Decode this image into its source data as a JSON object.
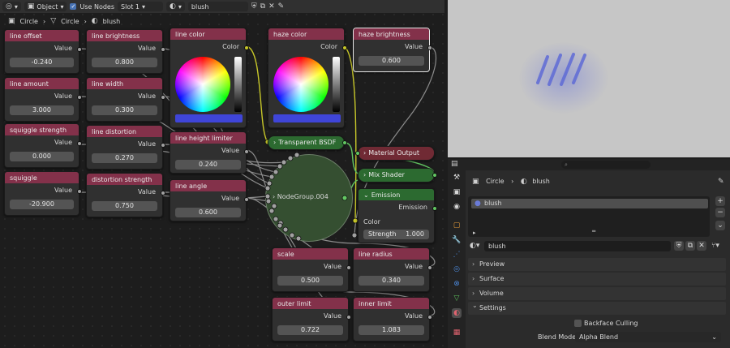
{
  "header": {
    "mode": "Object",
    "use_nodes_label": "Use Nodes",
    "slot": "Slot 1",
    "material": "blush"
  },
  "breadcrumb": {
    "object": "Circle",
    "mesh": "Circle",
    "material": "blush"
  },
  "value_nodes": [
    {
      "title": "line offset",
      "label": "Value",
      "value": "-0.240"
    },
    {
      "title": "line brightness",
      "label": "Value",
      "value": "0.800"
    },
    {
      "title": "line amount",
      "label": "Value",
      "value": "3.000"
    },
    {
      "title": "line width",
      "label": "Value",
      "value": "0.300"
    },
    {
      "title": "squiggle strength",
      "label": "Value",
      "value": "0.000"
    },
    {
      "title": "line distortion",
      "label": "Value",
      "value": "0.270"
    },
    {
      "title": "squiggle",
      "label": "Value",
      "value": "-20.900"
    },
    {
      "title": "distortion strength",
      "label": "Value",
      "value": "0.750"
    },
    {
      "title": "line height limiter",
      "label": "Value",
      "value": "0.240"
    },
    {
      "title": "line angle",
      "label": "Value",
      "value": "0.600"
    },
    {
      "title": "haze brightness",
      "label": "Value",
      "value": "0.600"
    },
    {
      "title": "scale",
      "label": "Value",
      "value": "0.500"
    },
    {
      "title": "line radius",
      "label": "Value",
      "value": "0.340"
    },
    {
      "title": "outer limit",
      "label": "Value",
      "value": "0.722"
    },
    {
      "title": "inner limit",
      "label": "Value",
      "value": "1.083"
    }
  ],
  "color_nodes": [
    {
      "title": "line color",
      "label": "Color",
      "swatch": "#3f45d8"
    },
    {
      "title": "haze color",
      "label": "Color",
      "swatch": "#3f45d8"
    }
  ],
  "shader_nodes": {
    "transparent": "Transparent BSDF",
    "material_output": "Material Output",
    "mix_shader": "Mix Shader",
    "emission": "Emission",
    "emission_out": "Emission",
    "emission_color": "Color",
    "strength_label": "Strength",
    "strength_value": "1.000",
    "group": "NodeGroup.004"
  },
  "properties": {
    "search_placeholder": "",
    "object": "Circle",
    "material": "blush",
    "slot_name": "blush",
    "material_field": "blush",
    "sections": [
      "Preview",
      "Surface",
      "Volume",
      "Settings"
    ],
    "backface_label": "Backface Culling",
    "blend_mode_label": "Blend Mode",
    "blend_mode_value": "Alpha Blend"
  },
  "colors": {
    "value_header": "#83314a",
    "shader_header": "#2c6a30",
    "swatch": "#3f45d8",
    "accent": "#4772b3"
  }
}
